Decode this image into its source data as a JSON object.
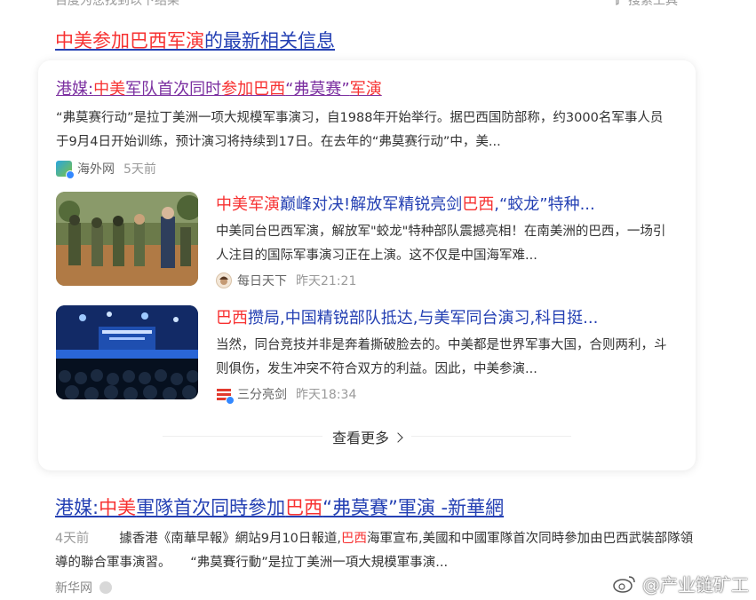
{
  "top": {
    "left_text": "百度为您找到以下结果",
    "right_text": "搜索工具"
  },
  "news_header": {
    "hl": "中美参加巴西军演",
    "rest": "的最新相关信息"
  },
  "card": {
    "item1": {
      "title": [
        {
          "t": "港媒:",
          "hl": false
        },
        {
          "t": "中美",
          "hl": true
        },
        {
          "t": "军队首次同时",
          "hl": false
        },
        {
          "t": "参加巴西",
          "hl": true
        },
        {
          "t": "“弗莫赛”",
          "hl": false
        },
        {
          "t": "军演",
          "hl": true
        }
      ],
      "abstract": "“弗莫赛行动”是拉丁美洲一项大规模军事演习，自1988年开始举行。据巴西国防部称，约3000名军事人员于9月4日开始训练，预计演习将持续到17日。在去年的“弗莫赛行动”中，美...",
      "source": "海外网",
      "time": "5天前"
    },
    "item2": {
      "title": [
        {
          "t": "中美军演",
          "hl": true
        },
        {
          "t": "巅峰对决!解放军精锐亮剑",
          "hl": false
        },
        {
          "t": "巴西",
          "hl": true
        },
        {
          "t": ",“蛟龙”特种...",
          "hl": false
        }
      ],
      "abstract": "中美同台巴西军演，解放军\"蛟龙\"特种部队震撼亮相！在南美洲的巴西，一场引人注目的国际军事演习正在上演。这不仅是中国海军难...",
      "source": "每日天下",
      "time": "昨天21:21"
    },
    "item3": {
      "title": [
        {
          "t": "巴西",
          "hl": true
        },
        {
          "t": "攒局,中国精锐部队抵达,与美军同台演习,科目挺...",
          "hl": false
        }
      ],
      "abstract": "当然，同台竞技并非是奔着撕破脸去的。中美都是世界军事大国，合则两利，斗则俱伤，发生冲突不符合双方的利益。因此，中美参演...",
      "source": "三分亮剑",
      "time": "昨天18:34"
    },
    "more_label": "查看更多"
  },
  "result2": {
    "title": [
      {
        "t": "港媒:",
        "hl": false
      },
      {
        "t": "中美",
        "hl": true
      },
      {
        "t": "軍隊首次同時參加",
        "hl": false
      },
      {
        "t": "巴西",
        "hl": true
      },
      {
        "t": "“弗莫賽”軍演 -新華網",
        "hl": false
      }
    ],
    "date": "4天前",
    "abstract_pre": "據香港《南華早報》網站9月10日報道,",
    "abstract_hl": "巴西",
    "abstract_post": "海軍宣布,美國和中國軍隊首次同時參加由巴西武裝部隊領導的聯合軍事演習。　　“弗莫賽行動”是拉丁美洲一項大規模軍事演...",
    "source": "新华网"
  },
  "watermark": "@产业链矿工",
  "colors": {
    "link": "#2440b3",
    "highlight": "#f73131",
    "visited": "#7b2fa0"
  }
}
